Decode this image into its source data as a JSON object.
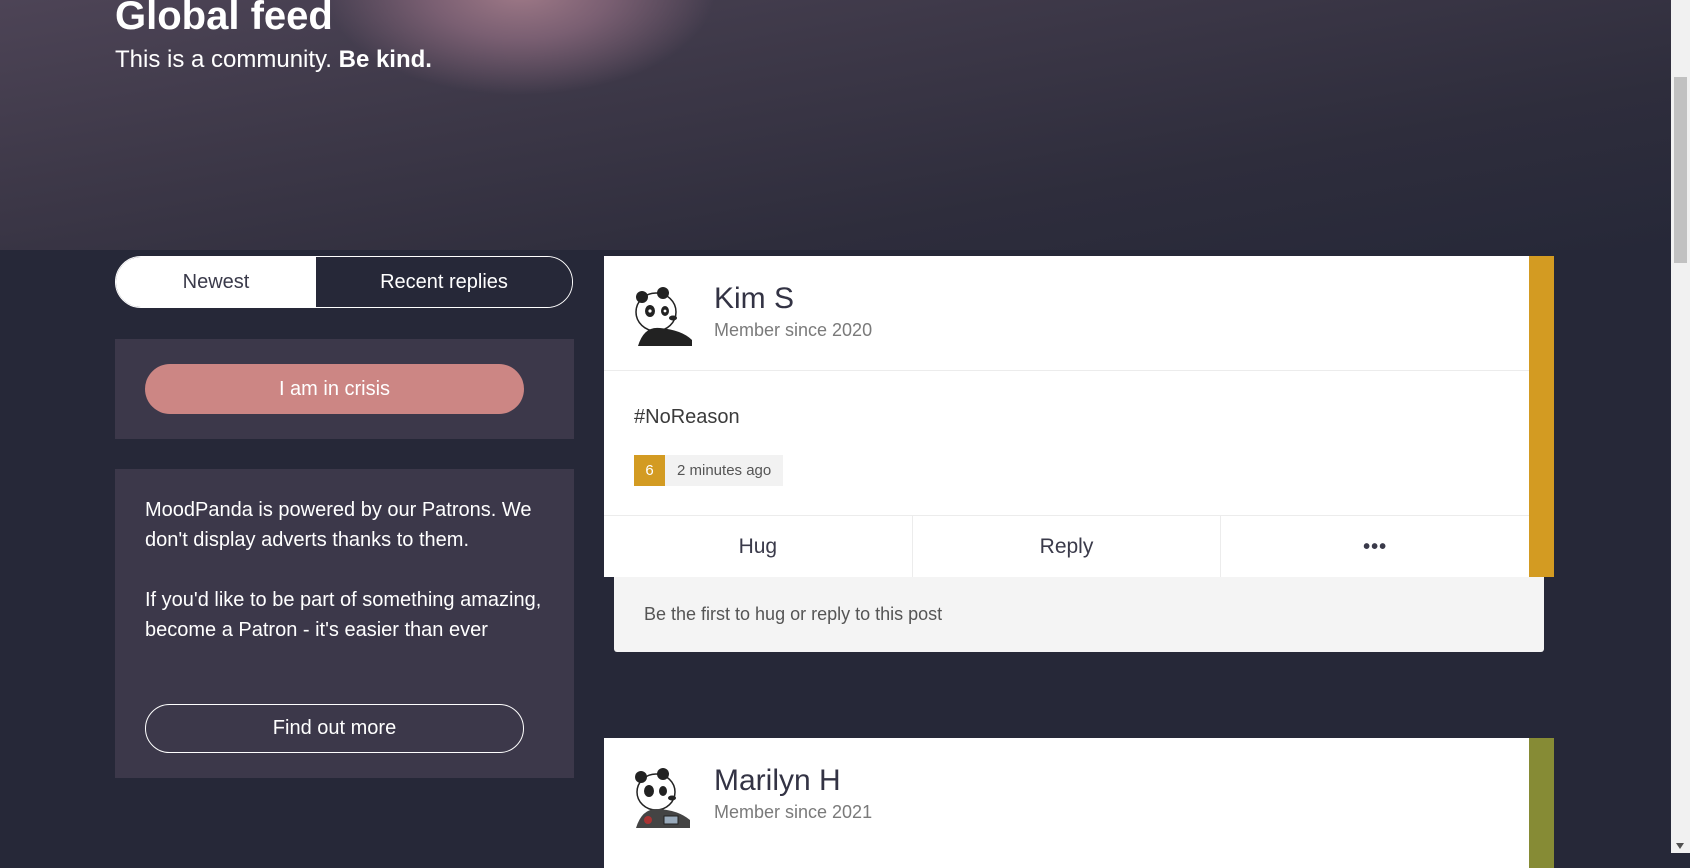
{
  "hero": {
    "title": "Global feed",
    "subtitle_prefix": "This is a community.",
    "subtitle_bold": "Be kind."
  },
  "sort_toggle": {
    "options": [
      "Newest",
      "Recent replies"
    ],
    "selected": "Recent replies"
  },
  "sidebar": {
    "crisis_button": "I am in crisis",
    "patron_text_1": "MoodPanda is powered by our Patrons. We don't display adverts thanks to them.",
    "patron_text_2": "If you'd like to be part of something amazing, become a Patron - it's easier than ever",
    "find_out_more": "Find out more"
  },
  "posts": [
    {
      "author": "Kim S",
      "member_since": "Member since 2020",
      "text": "#NoReason",
      "mood_score": "6",
      "time": "2 minutes ago",
      "mood_color": "#d39b22",
      "actions": [
        "Hug",
        "Reply",
        "•••"
      ],
      "replies_note": "Be the first to hug or reply to this post"
    },
    {
      "author": "Marilyn H",
      "member_since": "Member since 2021",
      "mood_color": "#868b35"
    }
  ],
  "colors": {
    "background": "#262838",
    "panel": "#3c384a",
    "crisis": "#cc8684"
  }
}
